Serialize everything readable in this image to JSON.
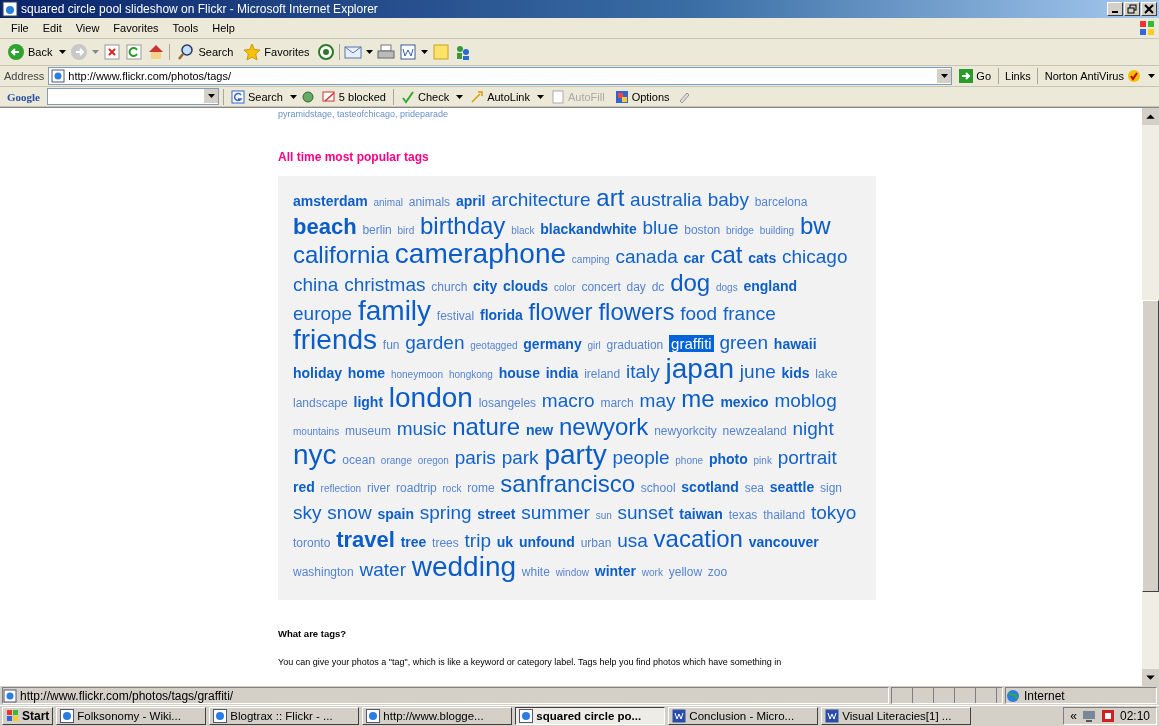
{
  "window": {
    "title": "squared circle pool slideshow on Flickr - Microsoft Internet Explorer"
  },
  "menu": [
    "File",
    "Edit",
    "View",
    "Favorites",
    "Tools",
    "Help"
  ],
  "toolbar": {
    "back": "Back",
    "search": "Search",
    "favorites": "Favorites"
  },
  "address": {
    "label": "Address",
    "value": "http://www.flickr.com/photos/tags/",
    "go": "Go",
    "links": "Links",
    "norton": "Norton AntiVirus"
  },
  "google_toolbar": {
    "logo": "Google",
    "search": "Search",
    "blocked": "5 blocked",
    "check": "Check",
    "autolink": "AutoLink",
    "autofill": {
      "label": "AutoFill",
      "disabled": true
    },
    "options": "Options"
  },
  "page": {
    "cut_line": "pyramidstage, tasteofchicago, prideparade",
    "heading": "All time most popular tags",
    "tags": [
      {
        "label": "amsterdam",
        "kind": "bold",
        "selected": false
      },
      {
        "label": "animal",
        "kind": "tiny",
        "selected": false
      },
      {
        "label": "animals",
        "kind": "small",
        "selected": false
      },
      {
        "label": "april",
        "kind": "bold",
        "selected": false
      },
      {
        "label": "architecture",
        "kind": "large",
        "selected": false
      },
      {
        "label": "art",
        "kind": "huge",
        "selected": false
      },
      {
        "label": "australia",
        "kind": "large",
        "selected": false
      },
      {
        "label": "baby",
        "kind": "large",
        "selected": false
      },
      {
        "label": "barcelona",
        "kind": "small",
        "selected": false
      },
      {
        "label": "beach",
        "kind": "heavy",
        "selected": false
      },
      {
        "label": "berlin",
        "kind": "small",
        "selected": false
      },
      {
        "label": "bird",
        "kind": "tiny",
        "selected": false
      },
      {
        "label": "birthday",
        "kind": "huge",
        "selected": false
      },
      {
        "label": "black",
        "kind": "tiny",
        "selected": false
      },
      {
        "label": "blackandwhite",
        "kind": "bold",
        "selected": false
      },
      {
        "label": "blue",
        "kind": "large",
        "selected": false
      },
      {
        "label": "boston",
        "kind": "small",
        "selected": false
      },
      {
        "label": "bridge",
        "kind": "tiny",
        "selected": false
      },
      {
        "label": "building",
        "kind": "tiny",
        "selected": false
      },
      {
        "label": "bw",
        "kind": "huge",
        "selected": false
      },
      {
        "label": "california",
        "kind": "huge",
        "selected": false
      },
      {
        "label": "cameraphone",
        "kind": "giant",
        "selected": false
      },
      {
        "label": "camping",
        "kind": "tiny",
        "selected": false
      },
      {
        "label": "canada",
        "kind": "large",
        "selected": false
      },
      {
        "label": "car",
        "kind": "bold",
        "selected": false
      },
      {
        "label": "cat",
        "kind": "huge",
        "selected": false
      },
      {
        "label": "cats",
        "kind": "bold",
        "selected": false
      },
      {
        "label": "chicago",
        "kind": "large",
        "selected": false
      },
      {
        "label": "china",
        "kind": "large",
        "selected": false
      },
      {
        "label": "christmas",
        "kind": "large",
        "selected": false
      },
      {
        "label": "church",
        "kind": "small",
        "selected": false
      },
      {
        "label": "city",
        "kind": "bold",
        "selected": false
      },
      {
        "label": "clouds",
        "kind": "bold",
        "selected": false
      },
      {
        "label": "color",
        "kind": "tiny",
        "selected": false
      },
      {
        "label": "concert",
        "kind": "small",
        "selected": false
      },
      {
        "label": "day",
        "kind": "small",
        "selected": false
      },
      {
        "label": "dc",
        "kind": "small",
        "selected": false
      },
      {
        "label": "dog",
        "kind": "huge",
        "selected": false
      },
      {
        "label": "dogs",
        "kind": "tiny",
        "selected": false
      },
      {
        "label": "england",
        "kind": "bold",
        "selected": false
      },
      {
        "label": "europe",
        "kind": "large",
        "selected": false
      },
      {
        "label": "family",
        "kind": "giant",
        "selected": false
      },
      {
        "label": "festival",
        "kind": "small",
        "selected": false
      },
      {
        "label": "florida",
        "kind": "bold",
        "selected": false
      },
      {
        "label": "flower",
        "kind": "huge",
        "selected": false
      },
      {
        "label": "flowers",
        "kind": "huge",
        "selected": false
      },
      {
        "label": "food",
        "kind": "large",
        "selected": false
      },
      {
        "label": "france",
        "kind": "large",
        "selected": false
      },
      {
        "label": "friends",
        "kind": "giant",
        "selected": false
      },
      {
        "label": "fun",
        "kind": "small",
        "selected": false
      },
      {
        "label": "garden",
        "kind": "large",
        "selected": false
      },
      {
        "label": "geotagged",
        "kind": "tiny",
        "selected": false
      },
      {
        "label": "germany",
        "kind": "bold",
        "selected": false
      },
      {
        "label": "girl",
        "kind": "tiny",
        "selected": false
      },
      {
        "label": "graduation",
        "kind": "small",
        "selected": false
      },
      {
        "label": "graffiti",
        "kind": "medium",
        "selected": true
      },
      {
        "label": "green",
        "kind": "large",
        "selected": false
      },
      {
        "label": "hawaii",
        "kind": "bold",
        "selected": false
      },
      {
        "label": "holiday",
        "kind": "bold",
        "selected": false
      },
      {
        "label": "home",
        "kind": "bold",
        "selected": false
      },
      {
        "label": "honeymoon",
        "kind": "tiny",
        "selected": false
      },
      {
        "label": "hongkong",
        "kind": "tiny",
        "selected": false
      },
      {
        "label": "house",
        "kind": "bold",
        "selected": false
      },
      {
        "label": "india",
        "kind": "bold",
        "selected": false
      },
      {
        "label": "ireland",
        "kind": "small",
        "selected": false
      },
      {
        "label": "italy",
        "kind": "large",
        "selected": false
      },
      {
        "label": "japan",
        "kind": "giant",
        "selected": false
      },
      {
        "label": "june",
        "kind": "large",
        "selected": false
      },
      {
        "label": "kids",
        "kind": "bold",
        "selected": false
      },
      {
        "label": "lake",
        "kind": "small",
        "selected": false
      },
      {
        "label": "landscape",
        "kind": "small",
        "selected": false
      },
      {
        "label": "light",
        "kind": "bold",
        "selected": false
      },
      {
        "label": "london",
        "kind": "giant",
        "selected": false
      },
      {
        "label": "losangeles",
        "kind": "small",
        "selected": false
      },
      {
        "label": "macro",
        "kind": "large",
        "selected": false
      },
      {
        "label": "march",
        "kind": "small",
        "selected": false
      },
      {
        "label": "may",
        "kind": "large",
        "selected": false
      },
      {
        "label": "me",
        "kind": "huge",
        "selected": false
      },
      {
        "label": "mexico",
        "kind": "bold",
        "selected": false
      },
      {
        "label": "moblog",
        "kind": "large",
        "selected": false
      },
      {
        "label": "mountains",
        "kind": "tiny",
        "selected": false
      },
      {
        "label": "museum",
        "kind": "small",
        "selected": false
      },
      {
        "label": "music",
        "kind": "large",
        "selected": false
      },
      {
        "label": "nature",
        "kind": "huge",
        "selected": false
      },
      {
        "label": "new",
        "kind": "bold",
        "selected": false
      },
      {
        "label": "newyork",
        "kind": "huge",
        "selected": false
      },
      {
        "label": "newyorkcity",
        "kind": "small",
        "selected": false
      },
      {
        "label": "newzealand",
        "kind": "small",
        "selected": false
      },
      {
        "label": "night",
        "kind": "large",
        "selected": false
      },
      {
        "label": "nyc",
        "kind": "giant",
        "selected": false
      },
      {
        "label": "ocean",
        "kind": "small",
        "selected": false
      },
      {
        "label": "orange",
        "kind": "tiny",
        "selected": false
      },
      {
        "label": "oregon",
        "kind": "tiny",
        "selected": false
      },
      {
        "label": "paris",
        "kind": "large",
        "selected": false
      },
      {
        "label": "park",
        "kind": "large",
        "selected": false
      },
      {
        "label": "party",
        "kind": "giant",
        "selected": false
      },
      {
        "label": "people",
        "kind": "large",
        "selected": false
      },
      {
        "label": "phone",
        "kind": "tiny",
        "selected": false
      },
      {
        "label": "photo",
        "kind": "bold",
        "selected": false
      },
      {
        "label": "pink",
        "kind": "tiny",
        "selected": false
      },
      {
        "label": "portrait",
        "kind": "large",
        "selected": false
      },
      {
        "label": "red",
        "kind": "bold",
        "selected": false
      },
      {
        "label": "reflection",
        "kind": "tiny",
        "selected": false
      },
      {
        "label": "river",
        "kind": "small",
        "selected": false
      },
      {
        "label": "roadtrip",
        "kind": "small",
        "selected": false
      },
      {
        "label": "rock",
        "kind": "tiny",
        "selected": false
      },
      {
        "label": "rome",
        "kind": "small",
        "selected": false
      },
      {
        "label": "sanfrancisco",
        "kind": "huge",
        "selected": false
      },
      {
        "label": "school",
        "kind": "small",
        "selected": false
      },
      {
        "label": "scotland",
        "kind": "bold",
        "selected": false
      },
      {
        "label": "sea",
        "kind": "small",
        "selected": false
      },
      {
        "label": "seattle",
        "kind": "bold",
        "selected": false
      },
      {
        "label": "sign",
        "kind": "small",
        "selected": false
      },
      {
        "label": "sky",
        "kind": "large",
        "selected": false
      },
      {
        "label": "snow",
        "kind": "large",
        "selected": false
      },
      {
        "label": "spain",
        "kind": "bold",
        "selected": false
      },
      {
        "label": "spring",
        "kind": "large",
        "selected": false
      },
      {
        "label": "street",
        "kind": "bold",
        "selected": false
      },
      {
        "label": "summer",
        "kind": "large",
        "selected": false
      },
      {
        "label": "sun",
        "kind": "tiny",
        "selected": false
      },
      {
        "label": "sunset",
        "kind": "large",
        "selected": false
      },
      {
        "label": "taiwan",
        "kind": "bold",
        "selected": false
      },
      {
        "label": "texas",
        "kind": "small",
        "selected": false
      },
      {
        "label": "thailand",
        "kind": "small",
        "selected": false
      },
      {
        "label": "tokyo",
        "kind": "large",
        "selected": false
      },
      {
        "label": "toronto",
        "kind": "small",
        "selected": false
      },
      {
        "label": "travel",
        "kind": "heavy",
        "selected": false
      },
      {
        "label": "tree",
        "kind": "bold",
        "selected": false
      },
      {
        "label": "trees",
        "kind": "small",
        "selected": false
      },
      {
        "label": "trip",
        "kind": "large",
        "selected": false
      },
      {
        "label": "uk",
        "kind": "bold",
        "selected": false
      },
      {
        "label": "unfound",
        "kind": "bold",
        "selected": false
      },
      {
        "label": "urban",
        "kind": "small",
        "selected": false
      },
      {
        "label": "usa",
        "kind": "large",
        "selected": false
      },
      {
        "label": "vacation",
        "kind": "huge",
        "selected": false
      },
      {
        "label": "vancouver",
        "kind": "bold",
        "selected": false
      },
      {
        "label": "washington",
        "kind": "small",
        "selected": false
      },
      {
        "label": "water",
        "kind": "large",
        "selected": false
      },
      {
        "label": "wedding",
        "kind": "giant",
        "selected": false
      },
      {
        "label": "white",
        "kind": "small",
        "selected": false
      },
      {
        "label": "window",
        "kind": "tiny",
        "selected": false
      },
      {
        "label": "winter",
        "kind": "bold",
        "selected": false
      },
      {
        "label": "work",
        "kind": "tiny",
        "selected": false
      },
      {
        "label": "yellow",
        "kind": "small",
        "selected": false
      },
      {
        "label": "zoo",
        "kind": "small",
        "selected": false
      }
    ],
    "info_heading": "What are tags?",
    "info_text": "You can give your photos a \"tag\", which is like a keyword or category label. Tags help you find photos which have something in"
  },
  "status_bar": {
    "url": "http://www.flickr.com/photos/tags/graffiti/",
    "zone": "Internet"
  },
  "taskbar": {
    "start": "Start",
    "tasks": [
      {
        "label": "Folksonomy - Wiki...",
        "kind": "browser",
        "selected": false
      },
      {
        "label": "Blogtrax :: Flickr - ...",
        "kind": "browser",
        "selected": false
      },
      {
        "label": "http://www.blogge...",
        "kind": "browser",
        "selected": false
      },
      {
        "label": "squared circle po...",
        "kind": "browser",
        "selected": true
      },
      {
        "label": "Conclusion - Micro...",
        "kind": "document",
        "selected": false
      },
      {
        "label": "Visual Literacies[1] ...",
        "kind": "document",
        "selected": false
      }
    ],
    "tray_toggle": "«",
    "clock": "02:10"
  }
}
